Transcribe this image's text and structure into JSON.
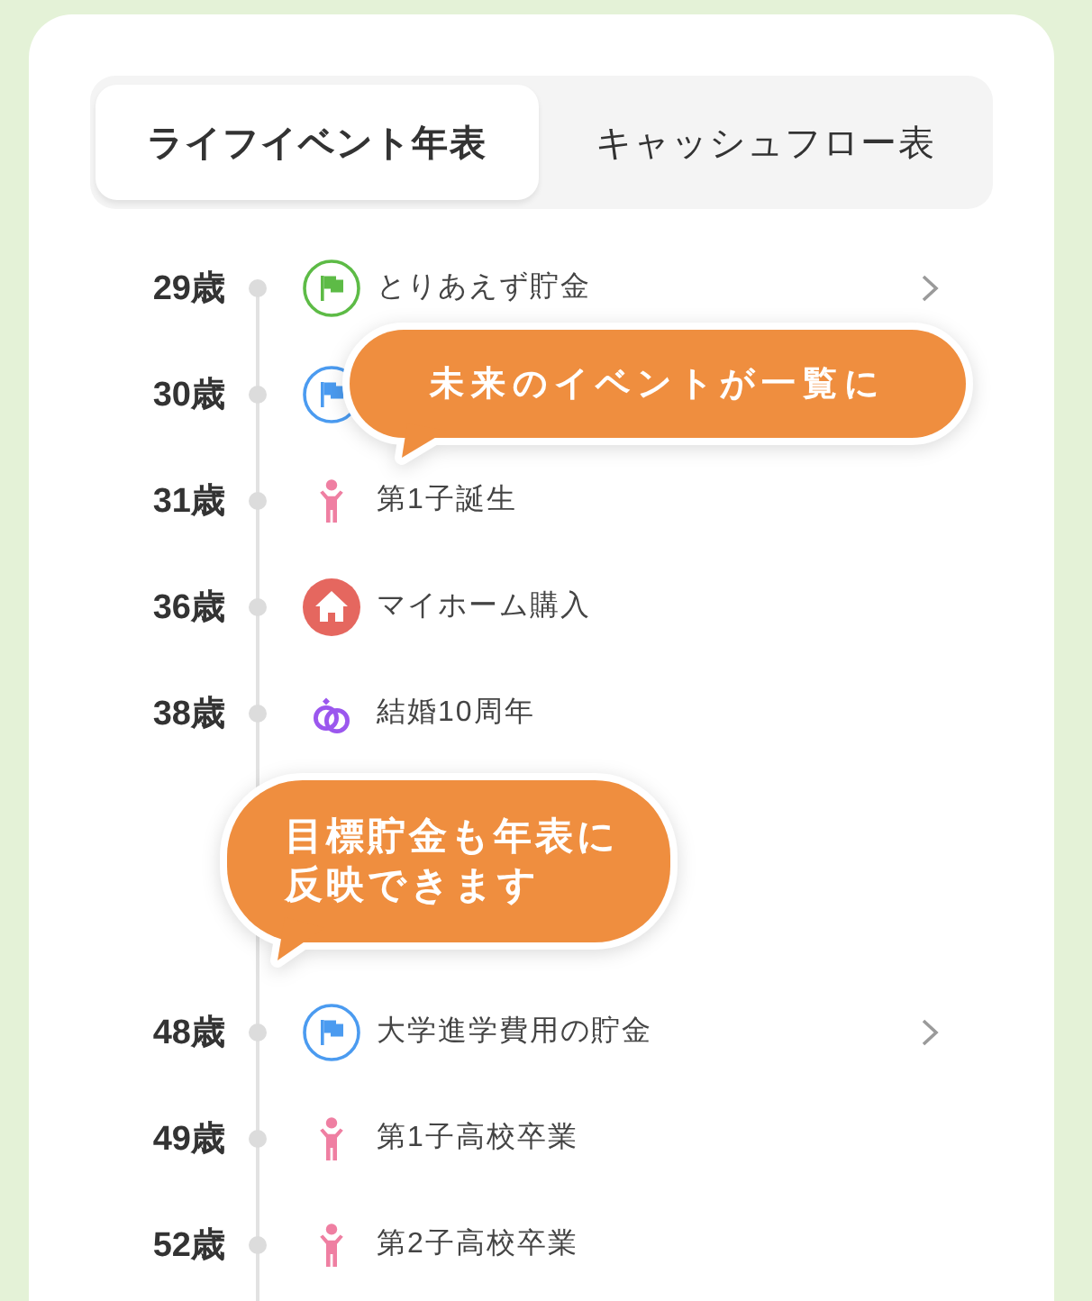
{
  "tabs": [
    {
      "label": "ライフイベント年表",
      "selected": true
    },
    {
      "label": "キャッシュフロー表",
      "selected": false
    }
  ],
  "timeline": [
    {
      "kind": "goal",
      "age": "29歳",
      "title": "とりあえず貯金",
      "color": "#5dbb46",
      "has_detail": true
    },
    {
      "kind": "goal",
      "age": "30歳",
      "color": "#4b9bf0",
      "has_detail": false,
      "callout": "未来のイベントが一覧に"
    },
    {
      "kind": "child",
      "age": "31歳",
      "title": "第1子誕生",
      "has_detail": false
    },
    {
      "kind": "home",
      "age": "36歳",
      "title": "マイホーム購入",
      "has_detail": false
    },
    {
      "kind": "anniversary",
      "age": "38歳",
      "title": "結婚10周年",
      "has_detail": false
    },
    {
      "kind": "callout",
      "text": "目標貯金も年表に反映できます"
    },
    {
      "kind": "goal",
      "age": "48歳",
      "title": "大学進学費用の貯金",
      "color": "#4b9bf0",
      "has_detail": true
    },
    {
      "kind": "child",
      "age": "49歳",
      "title": "第1子高校卒業",
      "has_detail": false
    },
    {
      "kind": "child",
      "age": "52歳",
      "title": "第2子高校卒業",
      "has_detail": false
    }
  ]
}
